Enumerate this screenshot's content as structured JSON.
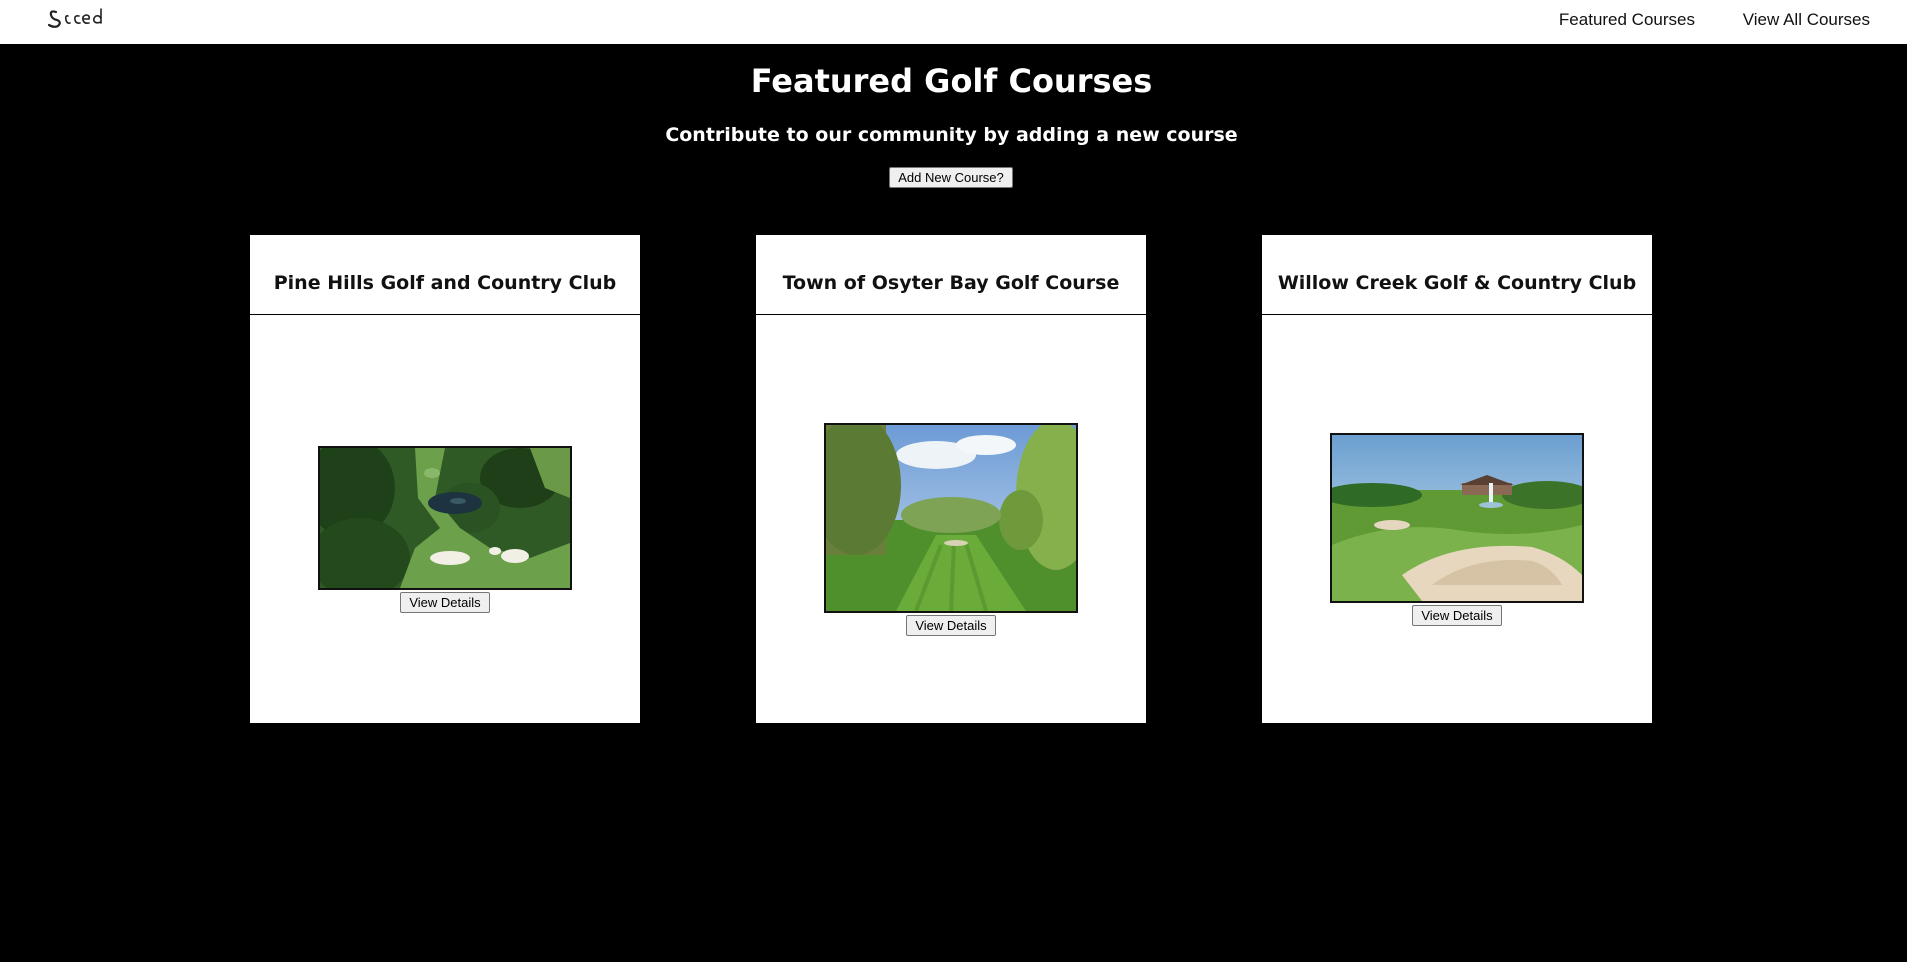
{
  "navbar": {
    "logo_text": "Sɔced",
    "links": [
      "Featured Courses",
      "View All Courses"
    ]
  },
  "main": {
    "title": "Featured Golf Courses",
    "subtitle": "Contribute to our community by adding a new course",
    "add_button_label": "Add New Course?"
  },
  "courses": [
    {
      "name": "Pine Hills Golf and Country Club",
      "button_label": "View Details",
      "image_icon": "aerial-golf-course-photo"
    },
    {
      "name": "Town of Osyter Bay Golf Course",
      "button_label": "View Details",
      "image_icon": "fairway-golf-course-photo"
    },
    {
      "name": "Willow Creek Golf & Country Club",
      "button_label": "View Details",
      "image_icon": "clubhouse-golf-course-photo"
    }
  ],
  "colors": {
    "background": "#000000",
    "navbar": "#ffffff",
    "card": "#ffffff"
  }
}
